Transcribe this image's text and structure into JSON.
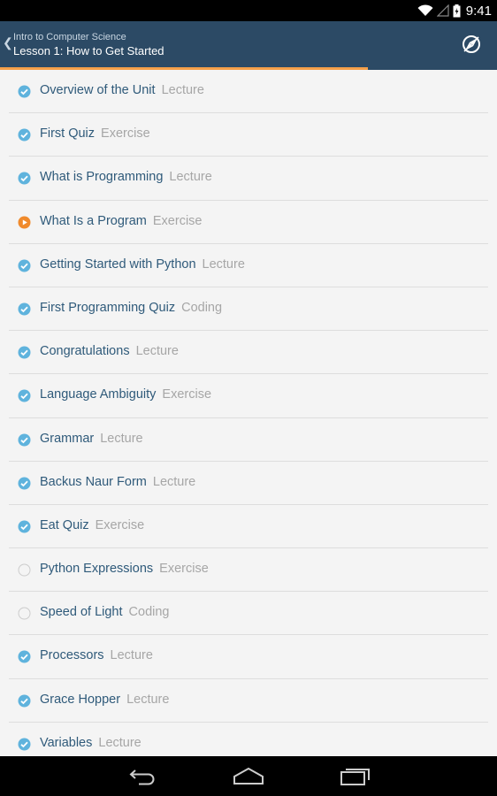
{
  "status_bar": {
    "time": "9:41"
  },
  "app_bar": {
    "course_title": "Intro to Computer Science",
    "lesson_title": "Lesson 1: How to Get Started"
  },
  "progress": {
    "fraction": 0.74
  },
  "lessons": [
    {
      "title": "Overview of the Unit",
      "type": "Lecture",
      "status": "done"
    },
    {
      "title": "First Quiz",
      "type": "Exercise",
      "status": "done"
    },
    {
      "title": "What is Programming",
      "type": "Lecture",
      "status": "done"
    },
    {
      "title": "What Is a Program",
      "type": "Exercise",
      "status": "current"
    },
    {
      "title": "Getting Started with Python",
      "type": "Lecture",
      "status": "done"
    },
    {
      "title": "First Programming Quiz",
      "type": "Coding",
      "status": "done"
    },
    {
      "title": "Congratulations",
      "type": "Lecture",
      "status": "done"
    },
    {
      "title": "Language Ambiguity",
      "type": "Exercise",
      "status": "done"
    },
    {
      "title": "Grammar",
      "type": "Lecture",
      "status": "done"
    },
    {
      "title": "Backus Naur Form",
      "type": "Lecture",
      "status": "done"
    },
    {
      "title": "Eat Quiz",
      "type": "Exercise",
      "status": "done"
    },
    {
      "title": "Python Expressions",
      "type": "Exercise",
      "status": "todo"
    },
    {
      "title": "Speed of Light",
      "type": "Coding",
      "status": "todo"
    },
    {
      "title": "Processors",
      "type": "Lecture",
      "status": "done"
    },
    {
      "title": "Grace Hopper",
      "type": "Lecture",
      "status": "done"
    },
    {
      "title": "Variables",
      "type": "Lecture",
      "status": "done"
    }
  ],
  "colors": {
    "done": "#5fb3dd",
    "current": "#f08a2c",
    "todo": "#cccccc"
  }
}
